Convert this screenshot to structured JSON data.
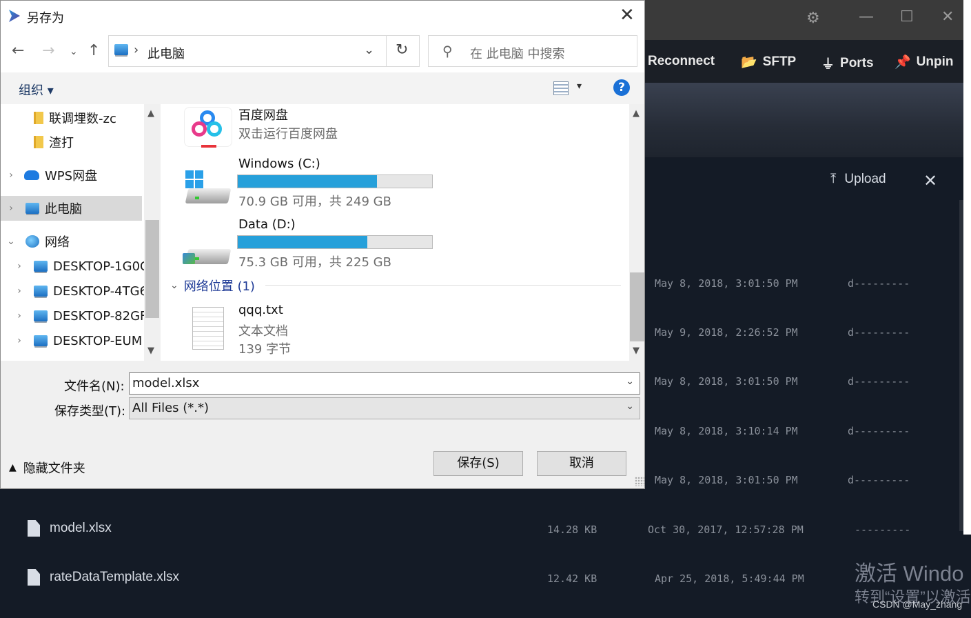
{
  "background_app": {
    "toolbar": {
      "reconnect": "Reconnect",
      "sftp": "SFTP",
      "ports": "Ports",
      "unpin": "Unpin"
    },
    "upload_label": "Upload",
    "rows": [
      {
        "date": "May 8, 2018, 3:01:50 PM",
        "perm": "d---------"
      },
      {
        "date": "May 9, 2018, 2:26:52 PM",
        "perm": "d---------"
      },
      {
        "date": "May 8, 2018, 3:01:50 PM",
        "perm": "d---------"
      },
      {
        "date": "May 8, 2018, 3:10:14 PM",
        "perm": "d---------"
      },
      {
        "date": "May 8, 2018, 3:01:50 PM",
        "perm": "d---------"
      }
    ],
    "files": [
      {
        "name": "model.xlsx",
        "size": "14.28 KB",
        "date": "Oct 30, 2017, 12:57:28 PM",
        "perm": "---------"
      },
      {
        "name": "rateDataTemplate.xlsx",
        "size": "12.42 KB",
        "date": "Apr 25, 2018, 5:49:44 PM",
        "perm": "---------"
      }
    ],
    "watermark_line1": "激活 Windo",
    "watermark_line2": "转到“设置”以激活",
    "credit": "CSDN @May_zhang"
  },
  "dialog": {
    "title": "另存为",
    "address": {
      "separator": "›",
      "location": "此电脑"
    },
    "search_placeholder": "在 此电脑 中搜索",
    "organize_label": "组织 ▾",
    "help_label": "?",
    "nav_items": [
      {
        "label": "联调埋数-zc",
        "icon": "folder-icon"
      },
      {
        "label": "渣打",
        "icon": "folder-icon"
      },
      {
        "label": "WPS网盘",
        "icon": "cloud-icon"
      },
      {
        "label": "此电脑",
        "icon": "computer-icon"
      },
      {
        "label": "网络",
        "icon": "network-icon"
      },
      {
        "label": "DESKTOP-1G0C",
        "icon": "computer-icon"
      },
      {
        "label": "DESKTOP-4TG6",
        "icon": "computer-icon"
      },
      {
        "label": "DESKTOP-82GF",
        "icon": "computer-icon"
      },
      {
        "label": "DESKTOP-EUM",
        "icon": "computer-icon"
      }
    ],
    "items": {
      "baidu": {
        "name": "百度网盘",
        "desc": "双击运行百度网盘"
      },
      "drive_c": {
        "name": "Windows (C:)",
        "space": "70.9 GB 可用，共 249 GB",
        "used_fraction": 0.715
      },
      "drive_d": {
        "name": "Data (D:)",
        "space": "75.3 GB 可用，共 225 GB",
        "used_fraction": 0.665
      },
      "network_group": "网络位置 (1)",
      "file": {
        "name": "qqq.txt",
        "type": "文本文档",
        "size": "139 字节"
      }
    },
    "filename_label": "文件名(N):",
    "filename_value": "model.xlsx",
    "filetype_label": "保存类型(T):",
    "filetype_value": "All Files (*.*)",
    "hide_folders_label": "隐藏文件夹",
    "save_label": "保存(S)",
    "cancel_label": "取消",
    "colors": {
      "progress": "#26a0da",
      "selection": "#d9d9d9",
      "link": "#1e3a96"
    }
  }
}
